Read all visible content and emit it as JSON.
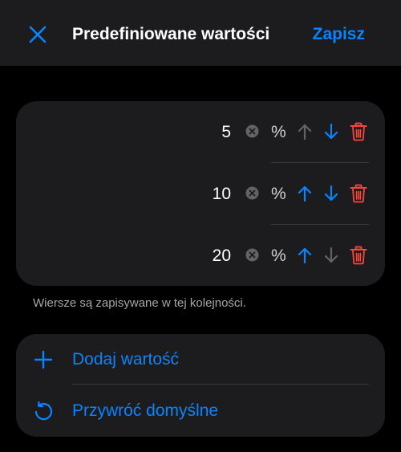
{
  "header": {
    "title": "Predefiniowane wartości",
    "save_label": "Zapisz",
    "close_icon": "close-icon"
  },
  "values": {
    "rows": [
      {
        "value": "5",
        "unit": "%",
        "up_enabled": false,
        "down_enabled": true
      },
      {
        "value": "10",
        "unit": "%",
        "up_enabled": true,
        "down_enabled": true
      },
      {
        "value": "20",
        "unit": "%",
        "up_enabled": true,
        "down_enabled": false
      }
    ]
  },
  "footnote": "Wiersze są zapisywane w tej kolejności.",
  "actions": {
    "add_label": "Dodaj wartość",
    "restore_label": "Przywróć domyślne"
  },
  "colors": {
    "accent": "#0a84ff",
    "destructive": "#ff453a",
    "disabled": "#636366",
    "card": "#1c1c1e",
    "background": "#000000"
  }
}
